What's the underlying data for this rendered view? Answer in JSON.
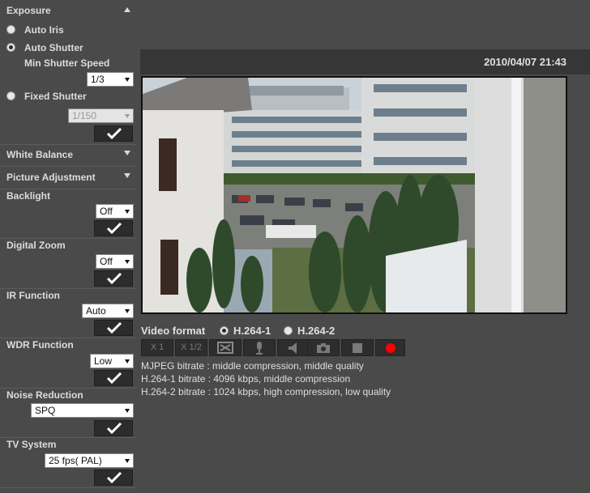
{
  "sidebar": {
    "exposure": {
      "title": "Exposure",
      "auto_iris": "Auto Iris",
      "auto_shutter": "Auto Shutter",
      "min_shutter_speed_label": "Min Shutter Speed",
      "min_shutter_speed_value": "1/3",
      "fixed_shutter": "Fixed Shutter",
      "fixed_shutter_value": "1/150",
      "selected": "Auto Shutter"
    },
    "white_balance": {
      "title": "White Balance"
    },
    "picture_adjustment": {
      "title": "Picture Adjustment"
    },
    "backlight": {
      "title": "Backlight",
      "value": "Off"
    },
    "digital_zoom": {
      "title": "Digital Zoom",
      "value": "Off"
    },
    "ir_function": {
      "title": "IR Function",
      "value": "Auto"
    },
    "wdr_function": {
      "title": "WDR Function",
      "value": "Low"
    },
    "noise_reduction": {
      "title": "Noise Reduction",
      "value": "SPQ"
    },
    "tv_system": {
      "title": "TV System",
      "value": "25 fps( PAL)"
    }
  },
  "video": {
    "timestamp": "2010/04/07 21:43",
    "format_label": "Video format",
    "format_options": [
      "H.264-1",
      "H.264-2"
    ],
    "selected_format": "H.264-1"
  },
  "controls": {
    "zoom_1": "X 1",
    "zoom_half": "X 1/2",
    "icons": [
      "fullscreen-icon",
      "microphone-icon",
      "speaker-icon",
      "camera-icon",
      "stop-icon",
      "record-icon"
    ],
    "record_color": "#ff0000"
  },
  "bitrate_info": [
    "MJPEG bitrate : middle compression, middle quality",
    "H.264-1 bitrate : 4096 kbps, middle compression",
    "H.264-2 bitrate : 1024 kbps, high compression, low quality"
  ]
}
